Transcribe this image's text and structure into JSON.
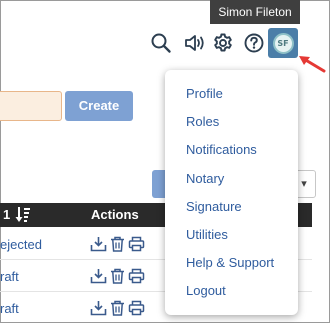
{
  "tooltip": {
    "text": "Simon Fileton"
  },
  "toolbar": {
    "icons": [
      "search-icon",
      "speaker-icon",
      "gear-icon",
      "help-icon"
    ],
    "avatar_initials": "SF",
    "avatar_color": "#4b7ea8"
  },
  "form": {
    "create_label": "Create"
  },
  "table": {
    "header_sort_label": "1",
    "header_actions_label": "Actions",
    "rows": [
      {
        "status": "ejected"
      },
      {
        "status": "raft"
      },
      {
        "status": "raft"
      }
    ]
  },
  "menu": {
    "items": [
      "Profile",
      "Roles",
      "Notifications",
      "Notary",
      "Signature",
      "Utilities",
      "Help & Support",
      "Logout"
    ]
  },
  "colors": {
    "link": "#2f5c9e",
    "button": "#7ea1d3",
    "arrow": "#e53935"
  }
}
